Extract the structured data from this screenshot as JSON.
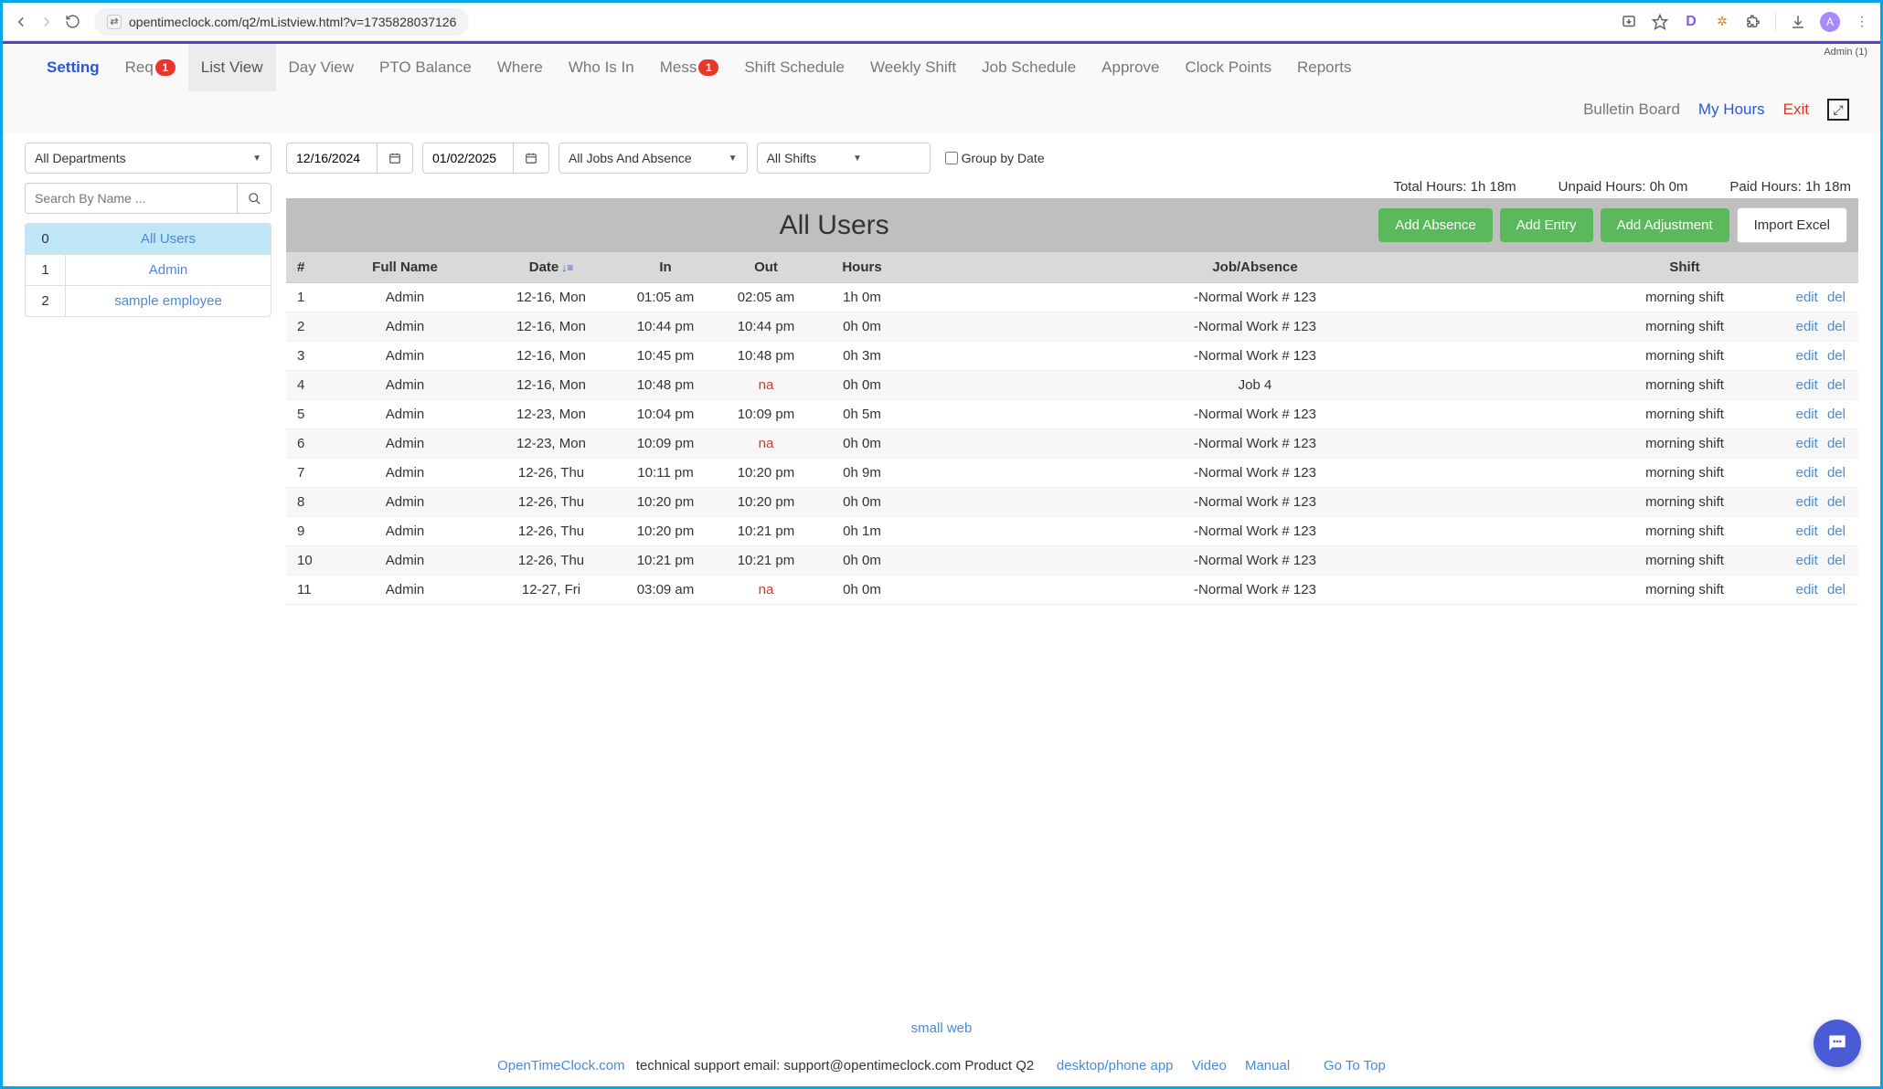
{
  "browser": {
    "url": "opentimeclock.com/q2/mListview.html?v=1735828037126",
    "avatar_letter": "A",
    "ext_d": "D"
  },
  "admin_label": "Admin (1)",
  "nav": {
    "setting": "Setting",
    "req": "Req",
    "req_badge": "1",
    "list_view": "List View",
    "day_view": "Day View",
    "pto": "PTO Balance",
    "where": "Where",
    "who": "Who Is In",
    "mess": "Mess",
    "mess_badge": "1",
    "shift_sched": "Shift Schedule",
    "weekly_shift": "Weekly Shift",
    "job_sched": "Job Schedule",
    "approve": "Approve",
    "clock_points": "Clock Points",
    "reports": "Reports"
  },
  "subnav": {
    "bulletin": "Bulletin Board",
    "my_hours": "My Hours",
    "exit": "Exit"
  },
  "sidebar": {
    "dept_select": "All Departments",
    "search_placeholder": "Search By Name ...",
    "users": [
      {
        "idx": "0",
        "name": "All Users",
        "active": true
      },
      {
        "idx": "1",
        "name": "Admin",
        "active": false
      },
      {
        "idx": "2",
        "name": "sample employee",
        "active": false
      }
    ]
  },
  "filters": {
    "date_from": "12/16/2024",
    "date_to": "01/02/2025",
    "job_select": "All Jobs And Absence",
    "shift_select": "All Shifts",
    "group_by_date": "Group by Date"
  },
  "summary": {
    "total": "Total Hours: 1h 18m",
    "unpaid": "Unpaid Hours: 0h 0m",
    "paid": "Paid Hours: 1h 18m"
  },
  "main": {
    "title": "All Users",
    "btn_absence": "Add Absence",
    "btn_entry": "Add Entry",
    "btn_adjust": "Add Adjustment",
    "btn_import": "Import Excel"
  },
  "table": {
    "headers": {
      "num": "#",
      "name": "Full Name",
      "date": "Date",
      "in": "In",
      "out": "Out",
      "hours": "Hours",
      "job": "Job/Absence",
      "shift": "Shift"
    },
    "edit": "edit",
    "del": "del",
    "rows": [
      {
        "n": "1",
        "name": "Admin",
        "date": "12-16, Mon",
        "in": "01:05 am",
        "out": "02:05 am",
        "hours": "1h 0m",
        "job": "-Normal Work # 123",
        "shift": "morning shift"
      },
      {
        "n": "2",
        "name": "Admin",
        "date": "12-16, Mon",
        "in": "10:44 pm",
        "out": "10:44 pm",
        "hours": "0h 0m",
        "job": "-Normal Work # 123",
        "shift": "morning shift"
      },
      {
        "n": "3",
        "name": "Admin",
        "date": "12-16, Mon",
        "in": "10:45 pm",
        "out": "10:48 pm",
        "hours": "0h 3m",
        "job": "-Normal Work # 123",
        "shift": "morning shift"
      },
      {
        "n": "4",
        "name": "Admin",
        "date": "12-16, Mon",
        "in": "10:48 pm",
        "out": "na",
        "hours": "0h 0m",
        "job": "Job 4",
        "shift": "morning shift"
      },
      {
        "n": "5",
        "name": "Admin",
        "date": "12-23, Mon",
        "in": "10:04 pm",
        "out": "10:09 pm",
        "hours": "0h 5m",
        "job": "-Normal Work # 123",
        "shift": "morning shift"
      },
      {
        "n": "6",
        "name": "Admin",
        "date": "12-23, Mon",
        "in": "10:09 pm",
        "out": "na",
        "hours": "0h 0m",
        "job": "-Normal Work # 123",
        "shift": "morning shift"
      },
      {
        "n": "7",
        "name": "Admin",
        "date": "12-26, Thu",
        "in": "10:11 pm",
        "out": "10:20 pm",
        "hours": "0h 9m",
        "job": "-Normal Work # 123",
        "shift": "morning shift"
      },
      {
        "n": "8",
        "name": "Admin",
        "date": "12-26, Thu",
        "in": "10:20 pm",
        "out": "10:20 pm",
        "hours": "0h 0m",
        "job": "-Normal Work # 123",
        "shift": "morning shift"
      },
      {
        "n": "9",
        "name": "Admin",
        "date": "12-26, Thu",
        "in": "10:20 pm",
        "out": "10:21 pm",
        "hours": "0h 1m",
        "job": "-Normal Work # 123",
        "shift": "morning shift"
      },
      {
        "n": "10",
        "name": "Admin",
        "date": "12-26, Thu",
        "in": "10:21 pm",
        "out": "10:21 pm",
        "hours": "0h 0m",
        "job": "-Normal Work # 123",
        "shift": "morning shift"
      },
      {
        "n": "11",
        "name": "Admin",
        "date": "12-27, Fri",
        "in": "03:09 am",
        "out": "na",
        "hours": "0h 0m",
        "job": "-Normal Work # 123",
        "shift": "morning shift"
      }
    ]
  },
  "footer": {
    "small_web": "small web",
    "brand": "OpenTimeClock.com",
    "support_text": " technical support email: support@opentimeclock.com Product Q2",
    "desktop": "desktop/phone app",
    "video": "Video",
    "manual": "Manual",
    "gotop": "Go To Top"
  }
}
